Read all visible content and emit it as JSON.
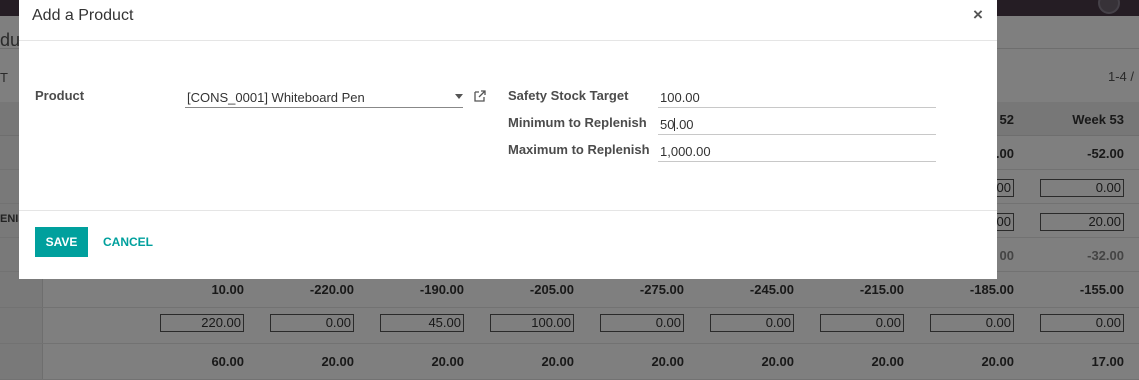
{
  "background": {
    "title_fragment": "dul",
    "toolbar_fragment": "T",
    "pager": "1-4 /",
    "side_label": "ENIS",
    "headers": [
      "52",
      "Week 53"
    ],
    "header_cells": [
      {
        "text": "52"
      },
      {
        "text": "Week 53"
      }
    ],
    "partial_rows": [
      [
        {
          "t": ".00",
          "type": "text"
        },
        {
          "t": "-52.00",
          "type": "text"
        }
      ],
      [
        {
          "t": "00",
          "type": "input"
        },
        {
          "t": "0.00",
          "type": "input"
        }
      ],
      [
        {
          "t": "00",
          "type": "input"
        },
        {
          "t": "20.00",
          "type": "input"
        }
      ],
      [
        {
          "t": "00",
          "type": "text",
          "muted": true
        },
        {
          "t": "-32.00",
          "type": "text",
          "muted": true
        }
      ]
    ],
    "full_rows": [
      {
        "type": "text",
        "cells": [
          "10.00",
          "-220.00",
          "-190.00",
          "-205.00",
          "-275.00",
          "-245.00",
          "-215.00",
          "-185.00",
          "-155.00"
        ]
      },
      {
        "type": "input",
        "cells": [
          "220.00",
          "0.00",
          "45.00",
          "100.00",
          "0.00",
          "0.00",
          "0.00",
          "0.00",
          "0.00"
        ]
      },
      {
        "type": "text",
        "cells": [
          "60.00",
          "20.00",
          "20.00",
          "20.00",
          "20.00",
          "20.00",
          "20.00",
          "20.00",
          "17.00"
        ]
      }
    ]
  },
  "modal": {
    "title": "Add a Product",
    "close_label": "×",
    "product": {
      "label": "Product",
      "value": "[CONS_0001] Whiteboard Pen"
    },
    "safety_stock": {
      "label": "Safety Stock Target",
      "value": "100.00"
    },
    "min_replenish": {
      "label": "Minimum to Replenish",
      "value_before_cursor": "50",
      "value_after_cursor": ".00"
    },
    "max_replenish": {
      "label": "Maximum to Replenish",
      "value": "1,000.00"
    },
    "save_label": "SAVE",
    "cancel_label": "CANCEL"
  },
  "colors": {
    "accent": "#00a09d",
    "topbar": "#4a3a48"
  }
}
